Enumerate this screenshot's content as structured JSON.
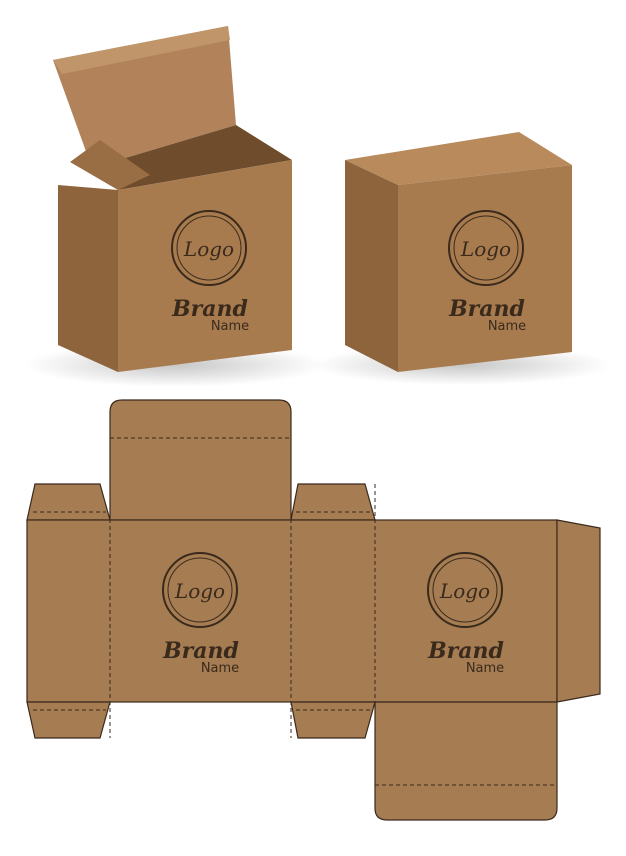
{
  "branding": {
    "logo_text": "Logo",
    "brand_text": "Brand",
    "name_text": "Name"
  },
  "colors": {
    "background": "#ffffff",
    "kraft_front": "#a87b4f",
    "kraft_side": "#94693f",
    "kraft_top": "#b88a5c",
    "kraft_inside": "#7d5734",
    "kraft_flat": "#a67c52",
    "ink": "#3a2a1c"
  },
  "scene": {
    "objects": [
      "open-box-mockup",
      "closed-box-mockup",
      "box-dieline"
    ]
  }
}
